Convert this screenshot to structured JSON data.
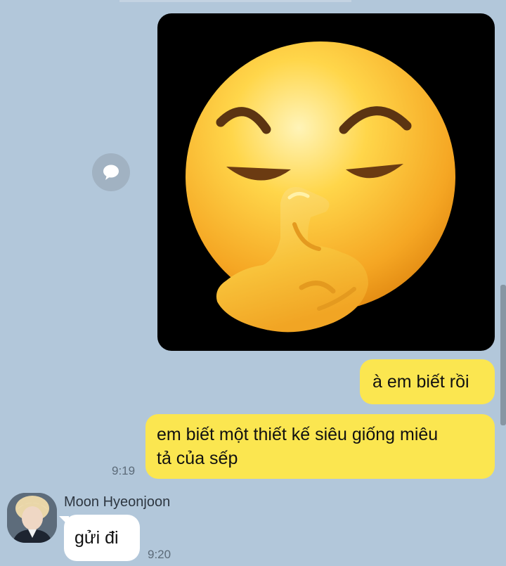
{
  "chat": {
    "messages": [
      {
        "sender": "me",
        "type": "sticker",
        "icon": "shushing-smirk-face-sticker"
      },
      {
        "sender": "me",
        "type": "text",
        "lines": [
          "à em biết rồi"
        ]
      },
      {
        "sender": "me",
        "type": "text",
        "lines": [
          "em biết một thiết kế siêu giống miêu",
          "tả của sếp"
        ],
        "time": "9:19"
      },
      {
        "sender": "Moon Hyeonjoon",
        "type": "text",
        "lines": [
          "gửi đi"
        ],
        "time": "9:20"
      }
    ],
    "share_icon": "speech-bubble-icon"
  },
  "colors": {
    "background": "#b2c7da",
    "my_bubble": "#fbe650",
    "their_bubble": "#ffffff",
    "timestamp": "#5c6b79"
  }
}
